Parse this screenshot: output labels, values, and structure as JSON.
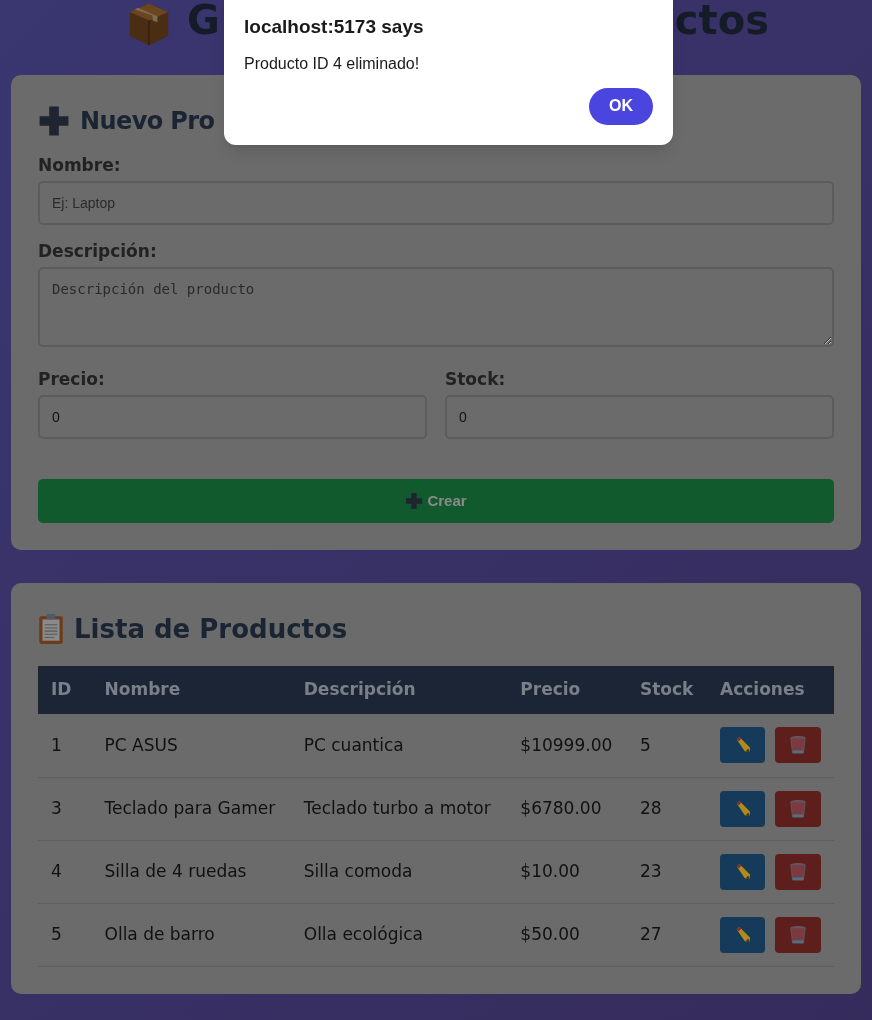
{
  "header": {
    "title_start": "G",
    "title_end": "ctos"
  },
  "alert": {
    "origin": "localhost:5173 says",
    "message": "Producto ID 4 eliminado!",
    "button": "OK"
  },
  "form": {
    "heading": "Nuevo Pro",
    "fields": [
      {
        "label": "Nombre:",
        "placeholder": "Ej: Laptop",
        "kind": "text"
      },
      {
        "label": "Descripción:",
        "placeholder": "Descripción del producto",
        "kind": "textarea"
      }
    ],
    "pair": [
      {
        "label": "Precio:",
        "value": "0"
      },
      {
        "label": "Stock:",
        "value": "0"
      }
    ],
    "submit": "Crear"
  },
  "list": {
    "heading": "Lista de Productos",
    "columns": [
      "ID",
      "Nombre",
      "Descripción",
      "Precio",
      "Stock",
      "Acciones"
    ],
    "rows": [
      [
        "1",
        "PC ASUS",
        "PC cuantica",
        "$10999.00",
        "5"
      ],
      [
        "3",
        "Teclado para Gamer",
        "Teclado turbo a motor",
        "$6780.00",
        "28"
      ],
      [
        "4",
        "Silla de 4 ruedas",
        "Silla comoda",
        "$10.00",
        "23"
      ],
      [
        "5",
        "Olla de barro",
        "Olla ecológica",
        "$50.00",
        "27"
      ]
    ]
  }
}
